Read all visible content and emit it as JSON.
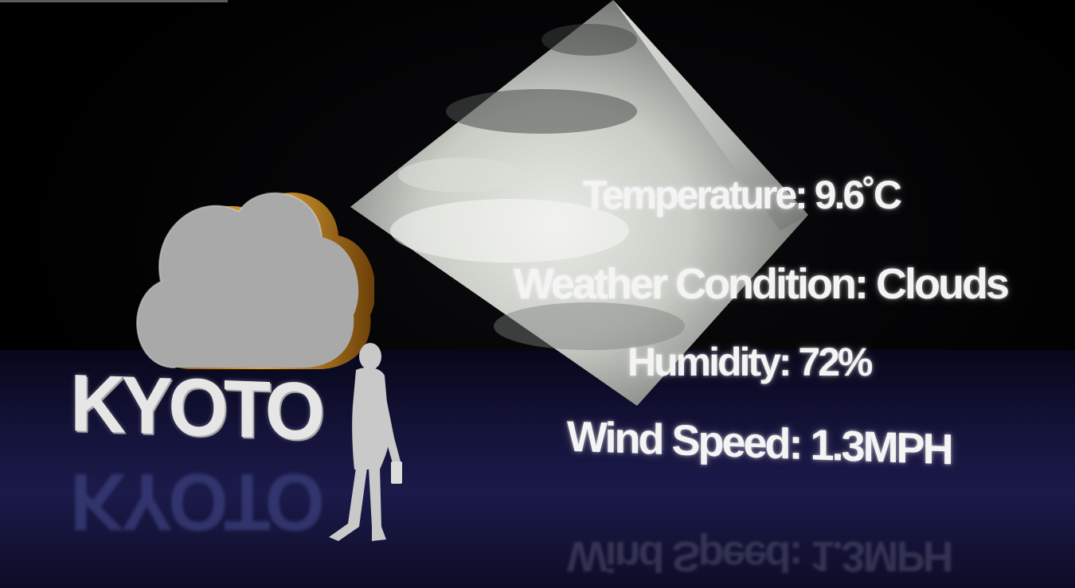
{
  "scene": {
    "city": "KYOTO",
    "cloud_icon": "cloud-icon",
    "colors": {
      "background": "#000000",
      "floor": "#1b1a4a",
      "text": "#f4f4f4",
      "cloud_face": "#a9a9a9",
      "cloud_rim": "#c8891c"
    }
  },
  "weather": {
    "temperature": "Temperature: 9.6˚C",
    "condition": "Weather Condition: Clouds",
    "humidity": "Humidity: 72%",
    "wind_speed": "Wind Speed: 1.3MPH"
  }
}
